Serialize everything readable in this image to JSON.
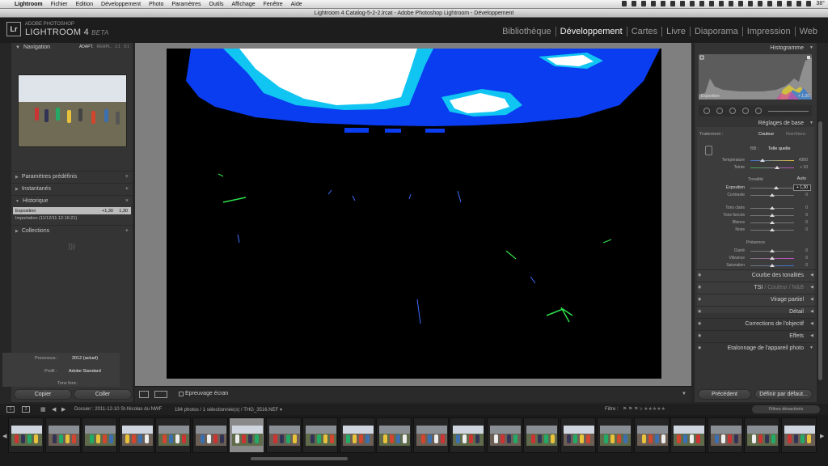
{
  "mac_menu": {
    "apple": "",
    "items": [
      "Lightroom",
      "Fichier",
      "Edition",
      "Développement",
      "Photo",
      "Paramètres",
      "Outils",
      "Affichage",
      "Fenêtre",
      "Aide"
    ],
    "clock": "38°"
  },
  "window_title": "Lightroom 4 Catalog-5-2-2.lrcat - Adobe Photoshop Lightroom - Développement",
  "brand": {
    "logo": "Lr",
    "line1": "ADOBE PHOTOSHOP",
    "line2": "LIGHTROOM 4",
    "beta": "BETA"
  },
  "modules": [
    "Bibliothèque",
    "Développement",
    "Cartes",
    "Livre",
    "Diaporama",
    "Impression",
    "Web"
  ],
  "left": {
    "navigator": {
      "title": "Navigation",
      "options": [
        "ADAPT.",
        "REMPL.",
        "1:1",
        "3:1"
      ]
    },
    "panels": {
      "presets": "Paramètres prédéfinis",
      "snapshots": "Instantanés",
      "history": "Historique",
      "collections": "Collections"
    },
    "history_items": [
      {
        "label": "Exposition",
        "v1": "+1,30",
        "v2": "1,30"
      },
      {
        "label": "Importation (11/12/11 12:16:21)",
        "v1": "",
        "v2": ""
      }
    ],
    "copy": "Copier",
    "paste": "Coller"
  },
  "toolbar": {
    "label": "Epreuvage écran"
  },
  "right": {
    "histogram_title": "Histogramme",
    "histogram_readout": "Exposition",
    "histogram_value": "+ 1,30",
    "basic_title": "Réglages de base",
    "treatment_label": "Traitement :",
    "treatment_color": "Couleur",
    "treatment_bw": "Noir/blanc",
    "wb_label": "BB :",
    "wb_value": "Telle quelle",
    "sliders1": [
      {
        "label": "Température",
        "value": "4300"
      },
      {
        "label": "Teinte",
        "value": "+ 10"
      }
    ],
    "tone_label": "Tonalité",
    "auto_label": "Auto",
    "sliders2": [
      {
        "label": "Exposition",
        "value": "+ 1,30"
      },
      {
        "label": "Contraste",
        "value": "0"
      }
    ],
    "sliders3": [
      {
        "label": "Tons clairs",
        "value": "0"
      },
      {
        "label": "Tons foncés",
        "value": "0"
      },
      {
        "label": "Blancs",
        "value": "0"
      },
      {
        "label": "Noirs",
        "value": "0"
      }
    ],
    "presence_label": "Présence",
    "sliders4": [
      {
        "label": "Clarté",
        "value": "0"
      },
      {
        "label": "Vibrance",
        "value": "0"
      },
      {
        "label": "Saturation",
        "value": "0"
      }
    ],
    "panels": [
      "Courbe des tonalités",
      "TSI",
      "Couleur",
      "N&B",
      "Virage partiel",
      "Détail",
      "Corrections de l'objectif",
      "Effets",
      "Etalonnage de l'appareil photo"
    ],
    "calib_process_label": "Processus :",
    "calib_process_value": "2012 (actuel)",
    "calib_profile_label": "Profil :",
    "calib_profile_value": "Adobe Standard",
    "calib_shadows": "Tons fonc.",
    "prev": "Précédent",
    "reset": "Définir par défaut..."
  },
  "filmstrip": {
    "page1": "1",
    "page2": "2",
    "source": "Dossier : 2011-12-10 St-Nicolas du NWF",
    "count": "184 photos / 1 sélectionnée(s) / THG_3516.NEF ▾",
    "filter_label": "Filtre :",
    "filter_value": "Filtres désactivés"
  }
}
